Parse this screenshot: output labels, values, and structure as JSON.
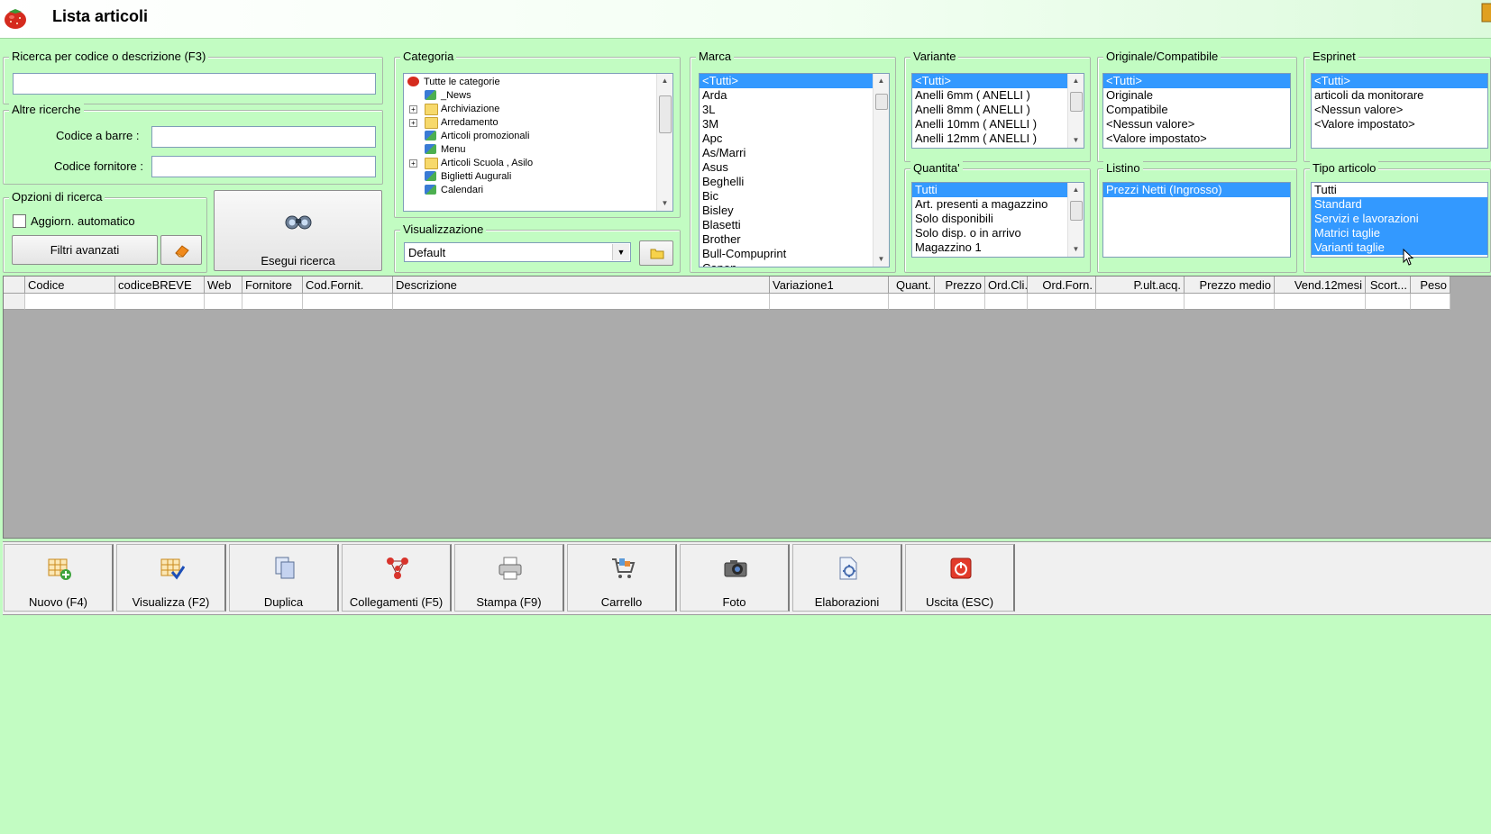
{
  "window": {
    "title": "Lista articoli"
  },
  "search": {
    "group_title": "Ricerca per codice o descrizione (F3)",
    "value": "",
    "other_title": "Altre ricerche",
    "barcode_label": "Codice a barre :",
    "barcode_value": "",
    "supplier_code_label": "Codice fornitore :",
    "supplier_code_value": "",
    "options_title": "Opzioni di ricerca",
    "auto_update_label": "Aggiorn. automatico",
    "auto_update_checked": false,
    "advanced_filters_label": "Filtri avanzati",
    "execute_label": "Esegui ricerca"
  },
  "categoria": {
    "title": "Categoria",
    "items": [
      {
        "label": "Tutte le categorie",
        "icon": "strawberry-icon",
        "expandable": false
      },
      {
        "label": "_News",
        "icon": "network-icon",
        "expandable": false
      },
      {
        "label": "Archiviazione",
        "icon": "folder-icon",
        "expandable": true
      },
      {
        "label": "Arredamento",
        "icon": "folder-icon",
        "expandable": true
      },
      {
        "label": "Articoli promozionali",
        "icon": "network-icon",
        "expandable": false
      },
      {
        "label": "Menu",
        "icon": "network-icon",
        "expandable": false
      },
      {
        "label": "Articoli Scuola , Asilo",
        "icon": "folder-icon",
        "expandable": true
      },
      {
        "label": "Biglietti Augurali",
        "icon": "network-icon",
        "expandable": false
      },
      {
        "label": "Calendari",
        "icon": "network-icon",
        "expandable": false
      }
    ]
  },
  "visualizzazione": {
    "title": "Visualizzazione",
    "selected": "Default"
  },
  "marca": {
    "title": "Marca",
    "items": [
      "<Tutti>",
      "Arda",
      "3L",
      "3M",
      "Apc",
      "As/Marri",
      "Asus",
      "Beghelli",
      "Bic",
      "Bisley",
      "Blasetti",
      "Brother",
      "Bull-Compuprint",
      "Canon"
    ],
    "selected": 0
  },
  "variante": {
    "title": "Variante",
    "items": [
      "<Tutti>",
      "Anelli  6mm ( ANELLI )",
      "Anelli  8mm ( ANELLI )",
      "Anelli 10mm ( ANELLI )",
      "Anelli 12mm ( ANELLI )"
    ],
    "selected": 0
  },
  "originale": {
    "title": "Originale/Compatibile",
    "items": [
      "<Tutti>",
      "Originale",
      "Compatibile",
      "<Nessun valore>",
      "<Valore impostato>"
    ],
    "selected": 0
  },
  "esprinet": {
    "title": "Esprinet",
    "items": [
      "<Tutti>",
      "articoli da monitorare",
      "<Nessun valore>",
      "<Valore impostato>"
    ],
    "selected": 0
  },
  "quantita": {
    "title": "Quantita'",
    "items": [
      "Tutti",
      "Art. presenti a magazzino",
      "Solo disponibili",
      "Solo disp. o in arrivo",
      "Magazzino 1"
    ],
    "selected": 0
  },
  "listino": {
    "title": "Listino",
    "items": [
      "Prezzi Netti (Ingrosso)"
    ],
    "selected": 0
  },
  "tipo_articolo": {
    "title": "Tipo articolo",
    "items": [
      "Tutti",
      "Standard",
      "Servizi e lavorazioni",
      "Matrici taglie",
      "Varianti taglie"
    ],
    "selected": [
      1,
      2,
      3,
      4
    ]
  },
  "grid": {
    "columns": [
      "",
      "Codice",
      "codiceBREVE",
      "Web",
      "Fornitore",
      "Cod.Fornit.",
      "Descrizione",
      "Variazione1",
      "Quant.",
      "Prezzo",
      "Ord.Cli.",
      "Ord.Forn.",
      "P.ult.acq.",
      "Prezzo medio",
      "Vend.12mesi",
      "Scort...",
      "Peso"
    ]
  },
  "toolbar": {
    "buttons": [
      {
        "label": "Nuovo (F4)",
        "icon": "new-grid-icon"
      },
      {
        "label": "Visualizza (F2)",
        "icon": "view-grid-icon"
      },
      {
        "label": "Duplica",
        "icon": "duplicate-icon"
      },
      {
        "label": "Collegamenti (F5)",
        "icon": "links-icon"
      },
      {
        "label": "Stampa (F9)",
        "icon": "printer-icon"
      },
      {
        "label": "Carrello",
        "icon": "cart-icon"
      },
      {
        "label": "Foto",
        "icon": "camera-icon"
      },
      {
        "label": "Elaborazioni",
        "icon": "processing-icon"
      },
      {
        "label": "Uscita (ESC)",
        "icon": "exit-icon"
      }
    ]
  },
  "colors": {
    "background": "#c2fcc2",
    "selection": "#3399ff",
    "grid_bg": "#ababab"
  }
}
